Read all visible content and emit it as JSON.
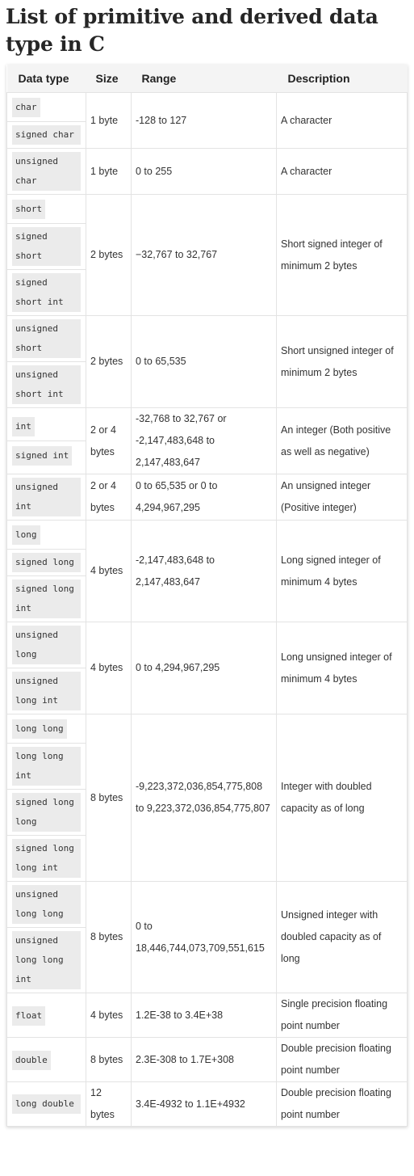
{
  "heading": "List of primitive and derived data type in C",
  "columns": {
    "data_type": "Data type",
    "size": "Size",
    "range": "Range",
    "description": "Description"
  },
  "rows": [
    {
      "types": [
        "char",
        "signed char"
      ],
      "size": "1 byte",
      "range": "-128 to 127",
      "description": "A character"
    },
    {
      "types": [
        "unsigned char"
      ],
      "size": "1 byte",
      "range": "0 to 255",
      "description": "A character"
    },
    {
      "types": [
        "short",
        "signed short",
        "signed short int"
      ],
      "size": "2 bytes",
      "range": "−32,767 to 32,767",
      "description": "Short signed integer of minimum 2 bytes"
    },
    {
      "types": [
        "unsigned short",
        "unsigned short int"
      ],
      "size": "2 bytes",
      "range": "0 to 65,535",
      "description": "Short unsigned integer of minimum 2 bytes"
    },
    {
      "types": [
        "int",
        "signed int"
      ],
      "size": "2 or 4 bytes",
      "range": "-32,768 to 32,767 or -2,147,483,648 to 2,147,483,647",
      "description": "An integer (Both positive as well as negative)"
    },
    {
      "types": [
        "unsigned int"
      ],
      "size": "2 or 4 bytes",
      "range": "0 to 65,535 or 0 to 4,294,967,295",
      "description": "An unsigned integer (Positive integer)"
    },
    {
      "types": [
        "long",
        "signed long",
        "signed long int"
      ],
      "size": "4 bytes",
      "range": "-2,147,483,648 to 2,147,483,647",
      "description": "Long signed integer of minimum 4 bytes"
    },
    {
      "types": [
        "unsigned long",
        "unsigned long int"
      ],
      "size": "4 bytes",
      "range": "0 to 4,294,967,295",
      "description": "Long unsigned integer of minimum 4 bytes"
    },
    {
      "types": [
        "long long",
        "long long int",
        "signed long long",
        "signed long long int"
      ],
      "size": "8 bytes",
      "range": "-9,223,372,036,854,775,808 to 9,223,372,036,854,775,807",
      "description": "Integer with doubled capacity as of long"
    },
    {
      "types": [
        "unsigned long long",
        "unsigned long long int"
      ],
      "size": "8 bytes",
      "range": "0 to 18,446,744,073,709,551,615",
      "description": "Unsigned integer with doubled capacity as of long"
    },
    {
      "types": [
        "float"
      ],
      "size": "4 bytes",
      "range": "1.2E-38 to 3.4E+38",
      "description": "Single precision floating point number"
    },
    {
      "types": [
        "double"
      ],
      "size": "8 bytes",
      "range": "2.3E-308 to 1.7E+308",
      "description": "Double precision floating point number"
    },
    {
      "types": [
        "long double"
      ],
      "size": "12 bytes",
      "range": "3.4E-4932 to 1.1E+4932",
      "description": "Double precision floating point number"
    }
  ]
}
